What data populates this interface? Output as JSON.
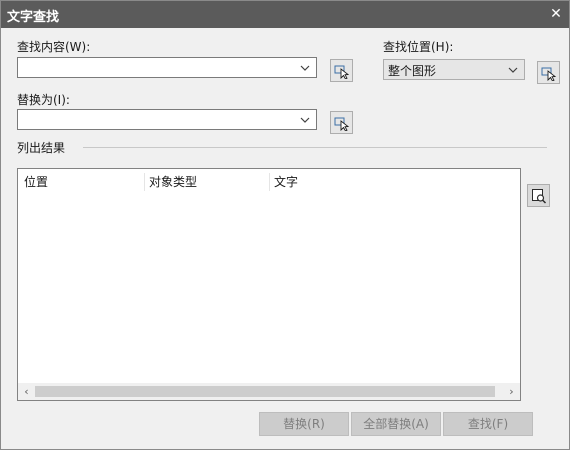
{
  "window": {
    "title": "文字查找"
  },
  "find_what": {
    "label": "查找内容(W):",
    "value": ""
  },
  "replace_with": {
    "label": "替换为(I):",
    "value": ""
  },
  "search_scope": {
    "label": "查找位置(H):",
    "value": "整个图形"
  },
  "results": {
    "label": "列出结果",
    "columns": [
      "位置",
      "对象类型",
      "文字"
    ]
  },
  "buttons": {
    "replace": "替换(R)",
    "replace_all": "全部替换(A)",
    "find": "查找(F)"
  },
  "icons": {
    "close": "close-icon",
    "pick": "select-objects-icon",
    "zoom": "zoom-to-selection-icon",
    "scroll_left": "‹",
    "scroll_right": "›"
  }
}
